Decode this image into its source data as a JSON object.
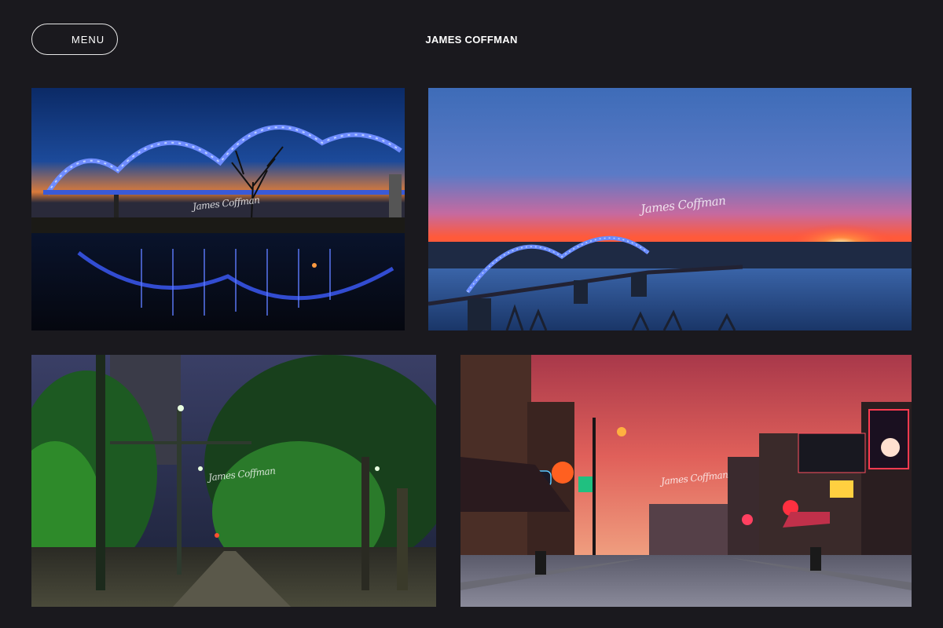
{
  "header": {
    "menu_label": "MENU",
    "site_title": "JAMES COFFMAN"
  },
  "gallery": [
    {
      "subject": "blue lit arch bridge at dusk reflected in water with bare tree",
      "watermark": "James Coffman"
    },
    {
      "subject": "arch bridge over river at sunset",
      "watermark": "James Coffman"
    },
    {
      "subject": "tree-lined street with green lights and trolley tracks at night",
      "watermark": "James Coffman"
    },
    {
      "subject": "neon-lit street with red sunset sky",
      "watermark": "James Coffman"
    }
  ]
}
